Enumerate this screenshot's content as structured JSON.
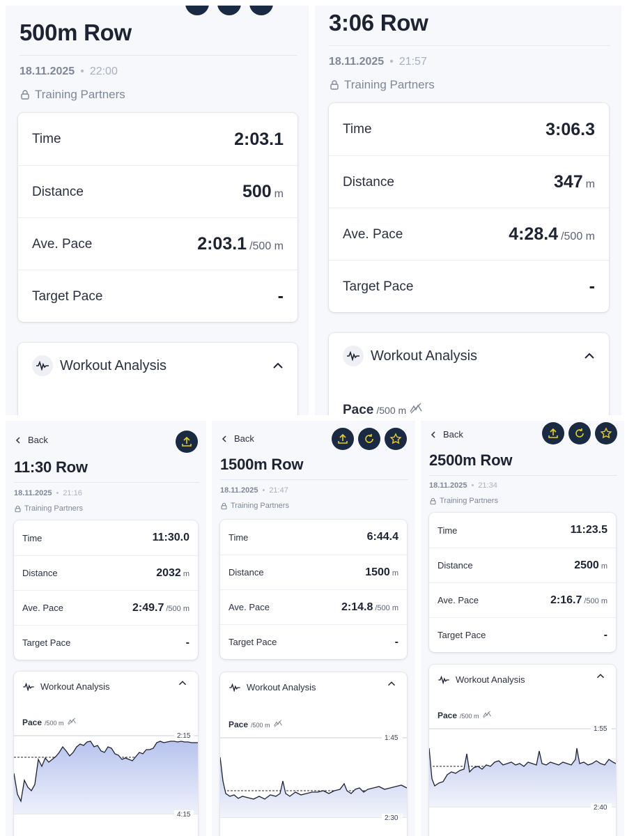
{
  "panels": [
    {
      "id": "tl",
      "title": "500m Row",
      "date": "18.11.2025",
      "time": "22:00",
      "partners": "Training Partners",
      "stats": [
        {
          "label": "Time",
          "value": "2:03.1",
          "unit": ""
        },
        {
          "label": "Distance",
          "value": "500",
          "unit": "m"
        },
        {
          "label": "Ave. Pace",
          "value": "2:03.1",
          "unit": "/500 m"
        },
        {
          "label": "Target Pace",
          "value": "-",
          "unit": ""
        }
      ],
      "analysis_title": "Workout Analysis"
    },
    {
      "id": "tr",
      "title": "3:06 Row",
      "date": "18.11.2025",
      "time": "21:57",
      "partners": "Training Partners",
      "stats": [
        {
          "label": "Time",
          "value": "3:06.3",
          "unit": ""
        },
        {
          "label": "Distance",
          "value": "347",
          "unit": "m"
        },
        {
          "label": "Ave. Pace",
          "value": "4:28.4",
          "unit": "/500 m"
        },
        {
          "label": "Target Pace",
          "value": "-",
          "unit": ""
        }
      ],
      "analysis_title": "Workout Analysis",
      "pace_label": "Pace",
      "pace_unit": "/500 m"
    },
    {
      "id": "bl",
      "back": "Back",
      "title": "11:30 Row",
      "date": "18.11.2025",
      "time": "21:16",
      "partners": "Training Partners",
      "stats": [
        {
          "label": "Time",
          "value": "11:30.0",
          "unit": ""
        },
        {
          "label": "Distance",
          "value": "2032",
          "unit": "m"
        },
        {
          "label": "Ave. Pace",
          "value": "2:49.7",
          "unit": "/500 m"
        },
        {
          "label": "Target Pace",
          "value": "-",
          "unit": ""
        }
      ],
      "analysis_title": "Workout Analysis",
      "pace_label": "Pace",
      "pace_unit": "/500 m",
      "axis_top": "2:15",
      "axis_bottom": "4:15"
    },
    {
      "id": "bm",
      "back": "Back",
      "title": "1500m Row",
      "date": "18.11.2025",
      "time": "21:47",
      "partners": "Training Partners",
      "stats": [
        {
          "label": "Time",
          "value": "6:44.4",
          "unit": ""
        },
        {
          "label": "Distance",
          "value": "1500",
          "unit": "m"
        },
        {
          "label": "Ave. Pace",
          "value": "2:14.8",
          "unit": "/500 m"
        },
        {
          "label": "Target Pace",
          "value": "-",
          "unit": ""
        }
      ],
      "analysis_title": "Workout Analysis",
      "pace_label": "Pace",
      "pace_unit": "/500 m",
      "axis_top": "1:45",
      "axis_bottom": "2:30"
    },
    {
      "id": "br",
      "back": "Back",
      "title": "2500m Row",
      "date": "18.11.2025",
      "time": "21:34",
      "partners": "Training Partners",
      "stats": [
        {
          "label": "Time",
          "value": "11:23.5",
          "unit": ""
        },
        {
          "label": "Distance",
          "value": "2500",
          "unit": "m"
        },
        {
          "label": "Ave. Pace",
          "value": "2:16.7",
          "unit": "/500 m"
        },
        {
          "label": "Target Pace",
          "value": "-",
          "unit": ""
        }
      ],
      "analysis_title": "Workout Analysis",
      "pace_label": "Pace",
      "pace_unit": "/500 m",
      "axis_top": "1:55",
      "axis_bottom": "2:40"
    }
  ],
  "icons": {
    "share": "upload-icon",
    "refresh": "refresh-icon",
    "favorite": "star-icon",
    "lock": "lock-icon",
    "wave": "waveform-icon",
    "chevron_up": "chevron-up-icon",
    "back": "chevron-left-icon",
    "compare": "compare-icon"
  },
  "colors": {
    "accent_button": "#1a2a43",
    "accent_icon": "#e8d21a",
    "chart_fill": "#c9d2f2",
    "chart_line": "#1d2332"
  }
}
